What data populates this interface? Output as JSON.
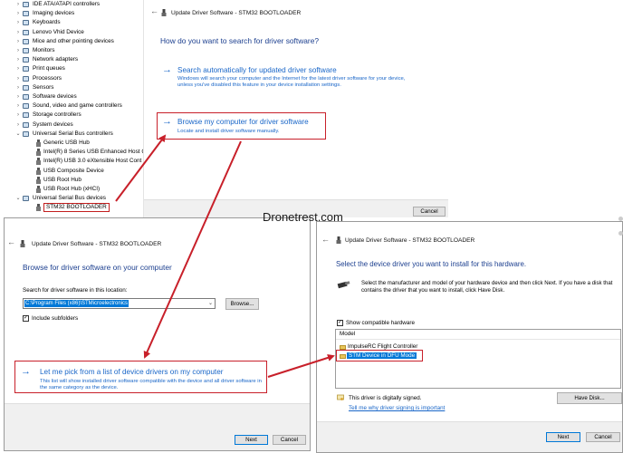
{
  "device_manager": {
    "items": [
      {
        "label": "IDE ATA/ATAPI controllers",
        "level": 0,
        "expanded": false
      },
      {
        "label": "Imaging devices",
        "level": 0,
        "expanded": false
      },
      {
        "label": "Keyboards",
        "level": 0,
        "expanded": false
      },
      {
        "label": "Lenovo Vhid Device",
        "level": 0,
        "expanded": false
      },
      {
        "label": "Mice and other pointing devices",
        "level": 0,
        "expanded": false
      },
      {
        "label": "Monitors",
        "level": 0,
        "expanded": false
      },
      {
        "label": "Network adapters",
        "level": 0,
        "expanded": false
      },
      {
        "label": "Print queues",
        "level": 0,
        "expanded": false
      },
      {
        "label": "Processors",
        "level": 0,
        "expanded": false
      },
      {
        "label": "Sensors",
        "level": 0,
        "expanded": false
      },
      {
        "label": "Software devices",
        "level": 0,
        "expanded": false
      },
      {
        "label": "Sound, video and game controllers",
        "level": 0,
        "expanded": false
      },
      {
        "label": "Storage controllers",
        "level": 0,
        "expanded": false
      },
      {
        "label": "System devices",
        "level": 0,
        "expanded": false
      },
      {
        "label": "Universal Serial Bus controllers",
        "level": 0,
        "expanded": true
      },
      {
        "label": "Generic USB Hub",
        "level": 1
      },
      {
        "label": "Intel(R) 8 Series USB Enhanced Host C",
        "level": 1
      },
      {
        "label": "Intel(R) USB 3.0 eXtensible Host Cont",
        "level": 1
      },
      {
        "label": "USB Composite Device",
        "level": 1
      },
      {
        "label": "USB Root Hub",
        "level": 1
      },
      {
        "label": "USB Root Hub (xHCI)",
        "level": 1
      },
      {
        "label": "Universal Serial Bus devices",
        "level": 0,
        "expanded": true
      },
      {
        "label": "STM32  BOOTLOADER",
        "level": 1,
        "selected": true
      }
    ]
  },
  "dialog1": {
    "title": "Update Driver Software - STM32  BOOTLOADER",
    "heading": "How do you want to search for driver software?",
    "option1": {
      "title": "Search automatically for updated driver software",
      "desc": "Windows will search your computer and the Internet for the latest driver software for your device, unless you've disabled this feature in your device installation settings."
    },
    "option2": {
      "title": "Browse my computer for driver software",
      "desc": "Locate and install driver software manually."
    },
    "cancel_label": "Cancel"
  },
  "watermark": "Dronetrest.com",
  "dialog2": {
    "title": "Update Driver Software - STM32  BOOTLOADER",
    "heading": "Browse for driver software on your computer",
    "search_label": "Search for driver software in this location:",
    "path_value": "C:\\Program Files (x86)\\STMicroelectronics",
    "browse_label": "Browse...",
    "include_subfolders": "Include subfolders",
    "include_subfolders_checked": true,
    "pick_option": {
      "title": "Let me pick from a list of device drivers on my computer",
      "desc": "This list will show installed driver software compatible with the device and all driver software in the same category as the device."
    },
    "next_label": "Next",
    "cancel_label": "Cancel"
  },
  "dialog3": {
    "title": "Update Driver Software - STM32  BOOTLOADER",
    "heading": "Select the device driver you want to install for this hardware.",
    "instructions": "Select the manufacturer and model of your hardware device and then click Next. If you have a disk that contains the driver that you want to install, click Have Disk.",
    "show_compatible": "Show compatible hardware",
    "show_compatible_checked": true,
    "model_header": "Model",
    "models": [
      {
        "label": "ImpulseRC Flight Controller",
        "selected": false
      },
      {
        "label": "STM Device in DFU Mode",
        "selected": true
      }
    ],
    "signed_text": "This driver is digitally signed.",
    "signing_link": "Tell me why driver signing is important",
    "have_disk_label": "Have Disk...",
    "next_label": "Next",
    "cancel_label": "Cancel"
  },
  "colors": {
    "link_blue": "#1966c8",
    "heading_blue": "#1c3f8f",
    "highlight_red": "#c8202a",
    "selection_blue": "#0078d7"
  }
}
